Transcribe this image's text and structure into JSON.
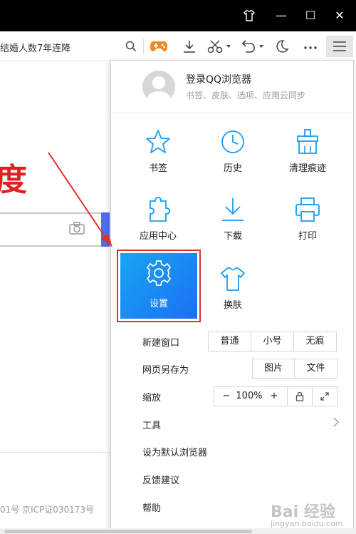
{
  "titlebar": {
    "skin_icon": "tshirt-icon",
    "minimize": "—",
    "maximize": "☐",
    "close": "✕"
  },
  "toolbar": {
    "address_text": "结婚人数7年连降",
    "icons": [
      "search-icon",
      "game-icon",
      "download-icon",
      "scissors-icon",
      "undo-icon",
      "moon-icon",
      "more-icon",
      "menu-icon"
    ]
  },
  "page": {
    "big_char": "度",
    "footer": "01号    京ICP证030173号"
  },
  "menu": {
    "login_title": "登录QQ浏览器",
    "login_sub": "书签、皮肤、选项、应用云同步",
    "grid": [
      {
        "label": "书签",
        "icon": "star-icon"
      },
      {
        "label": "历史",
        "icon": "clock-icon"
      },
      {
        "label": "清理痕迹",
        "icon": "broom-icon"
      },
      {
        "label": "应用中心",
        "icon": "puzzle-icon"
      },
      {
        "label": "下载",
        "icon": "download-icon"
      },
      {
        "label": "打印",
        "icon": "printer-icon"
      },
      {
        "label": "设置",
        "icon": "gear-icon"
      },
      {
        "label": "换肤",
        "icon": "tshirt-icon"
      }
    ],
    "new_window": {
      "label": "新建窗口",
      "options": [
        "普通",
        "小号",
        "无痕"
      ]
    },
    "save_as": {
      "label": "网页另存为",
      "options": [
        "图片",
        "文件"
      ]
    },
    "zoom": {
      "label": "缩放",
      "minus": "−",
      "value": "100%",
      "plus": "+"
    },
    "tools": "工具",
    "default_browser": "设为默认浏览器",
    "feedback": "反馈建议",
    "help": "帮助"
  },
  "watermark": {
    "text": "Bai 经验",
    "sub": "jingyan.baidu.com"
  },
  "colors": {
    "accent": "#1a9cf0",
    "selected_gradient_start": "#16a6f5",
    "selected_gradient_end": "#1d6ff2",
    "highlight_red": "#e03030"
  }
}
